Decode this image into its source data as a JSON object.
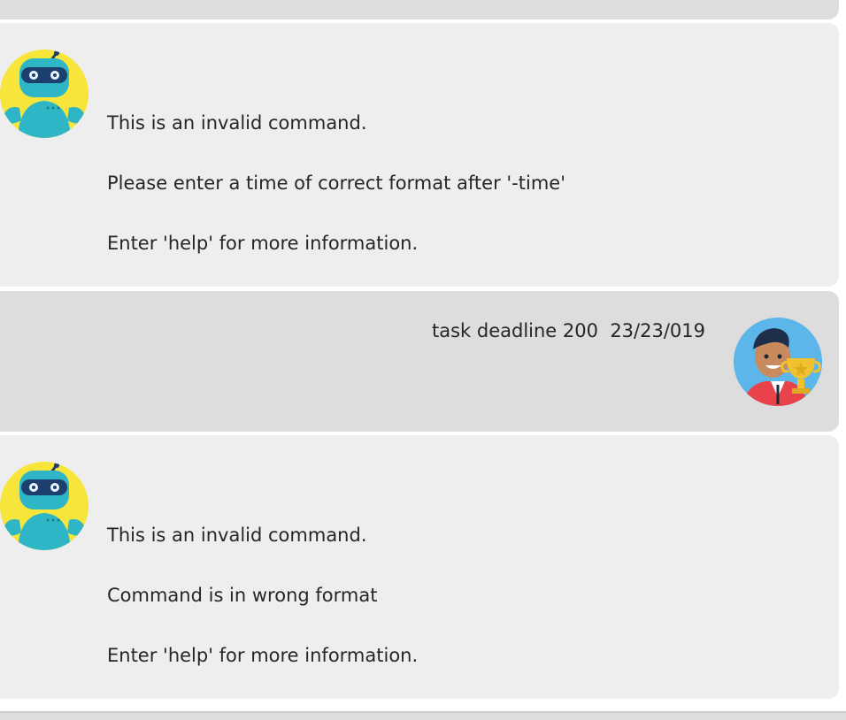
{
  "messages": [
    {
      "sender": "bot",
      "avatar_icon": "robot-avatar-icon",
      "lines": [
        "This is an invalid command.",
        "Please enter a time of correct format after '-time'",
        "Enter 'help' for more information."
      ]
    },
    {
      "sender": "user",
      "avatar_icon": "user-trophy-avatar-icon",
      "text": "task deadline 200  23/23/019"
    },
    {
      "sender": "bot",
      "avatar_icon": "robot-avatar-icon",
      "lines": [
        "This is an invalid command.",
        "Command is in wrong format",
        "Enter 'help' for more information."
      ]
    }
  ],
  "colors": {
    "bot_bubble": "#eeeeee",
    "user_bubble": "#dddddd",
    "text": "#262626",
    "bot_avatar_bg": "#f7e53b",
    "user_avatar_bg": "#5db6ea"
  }
}
